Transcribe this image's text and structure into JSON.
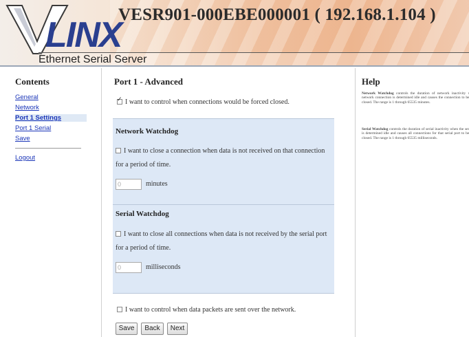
{
  "header": {
    "logo_text": "VLINX",
    "subtitle": "Ethernet Serial Server",
    "device_title": "VESR901-000EBE000001 ( 192.168.1.104 )"
  },
  "sidebar": {
    "title": "Contents",
    "items": [
      {
        "label": "General",
        "active": false
      },
      {
        "label": "Network",
        "active": false
      },
      {
        "label": "Port 1 Settings",
        "active": true
      },
      {
        "label": "Port 1 Serial",
        "active": false
      },
      {
        "label": "Save",
        "active": false
      }
    ],
    "logout_label": "Logout"
  },
  "main": {
    "title": "Port 1 - Advanced",
    "force_close_checkbox": {
      "label": "I want to control when connections would be forced closed.",
      "checked": true
    },
    "network_watchdog": {
      "title": "Network Watchdog",
      "checkbox_label": "I want to close a connection when data is not received on that connection for a period of time.",
      "checked": false,
      "input_value": "0",
      "unit": "minutes"
    },
    "serial_watchdog": {
      "title": "Serial Watchdog",
      "checkbox_label": "I want to close all connections when data is not received by the serial port for a period of time.",
      "checked": false,
      "input_value": "0",
      "unit": "milliseconds"
    },
    "packet_checkbox": {
      "label": "I want to control when data packets are sent over the network.",
      "checked": false
    },
    "buttons": {
      "save": "Save",
      "back": "Back",
      "next": "Next"
    }
  },
  "help": {
    "title": "Help",
    "network_term": "Network Watchdog",
    "network_text": "controls the duration of network inactivity when a network connection is determined idle and causes the connection to be forced closed. The range is 1 through 65535 minutes.",
    "serial_term": "Serial Watchdog",
    "serial_text": "controls the duration of serial inactivity when the serial port is determined idle and causes all connections for that serial port to be forced closed. The range is 1 through 65535 milliseconds."
  },
  "colors": {
    "link": "#1a35b8",
    "panel_bg": "#dde8f6",
    "logo_blue": "#2a3f8f",
    "header_orange": "#efbc98"
  }
}
